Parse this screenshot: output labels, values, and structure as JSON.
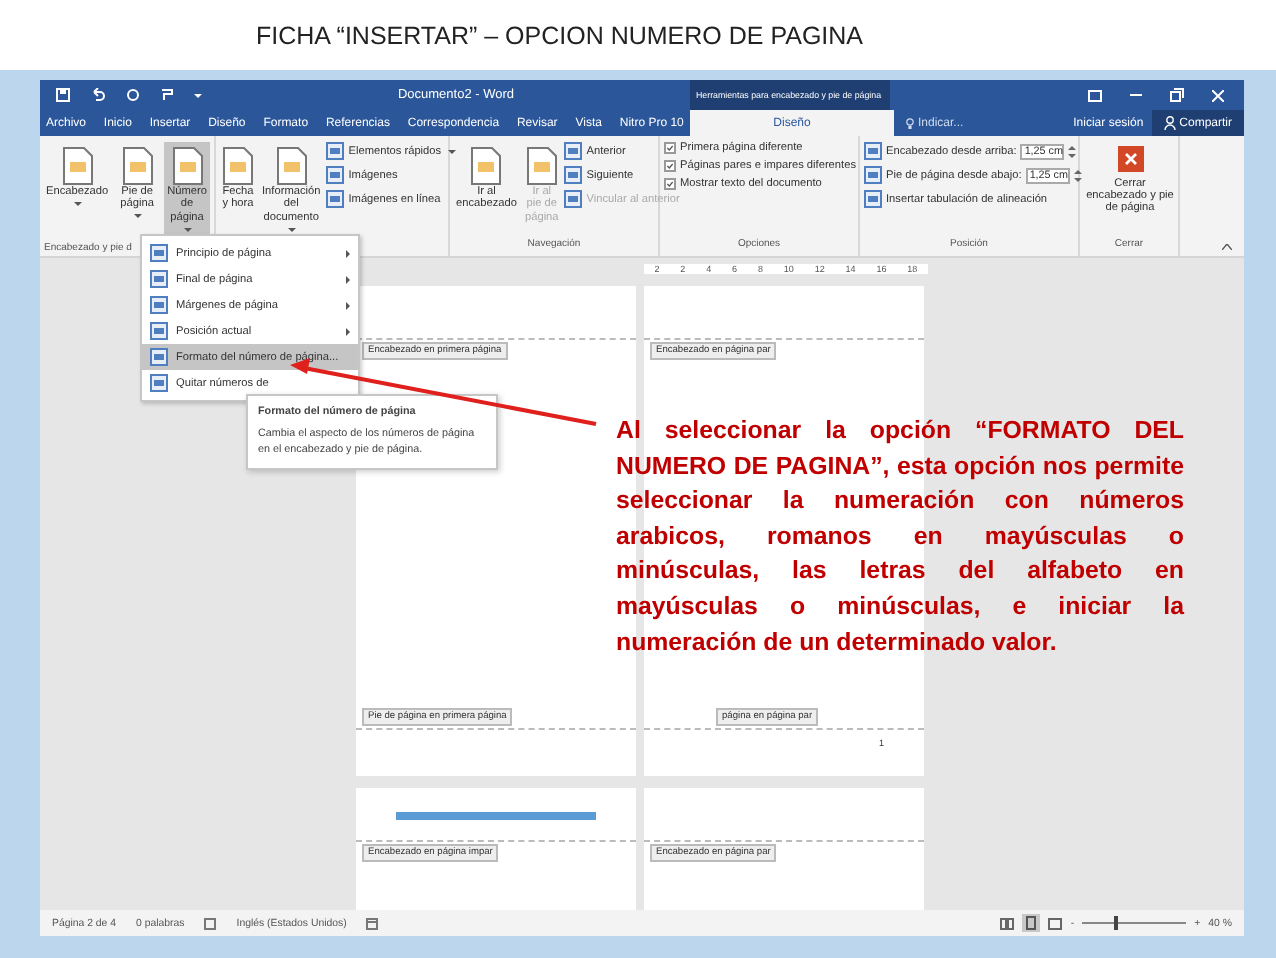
{
  "slide_title": "FICHA “INSERTAR” – OPCION NUMERO DE PAGINA",
  "window": {
    "title": "Documento2 - Word",
    "context_title": "Herramientas para encabezado y pie de página"
  },
  "tabs": [
    {
      "label": "Archivo",
      "selected": false
    },
    {
      "label": "Inicio",
      "selected": false
    },
    {
      "label": "Insertar",
      "selected": false
    },
    {
      "label": "Diseño",
      "selected": false
    },
    {
      "label": "Formato",
      "selected": false
    },
    {
      "label": "Referencias",
      "selected": false
    },
    {
      "label": "Correspondencia",
      "selected": false
    },
    {
      "label": "Revisar",
      "selected": false
    },
    {
      "label": "Vista",
      "selected": false
    },
    {
      "label": "Nitro Pro 10",
      "selected": false
    },
    {
      "label": "Diseño",
      "selected": true
    }
  ],
  "search": {
    "placeholder": "Indicar..."
  },
  "account": {
    "sign_in": "Iniciar sesión",
    "share": "Compartir"
  },
  "ribbon": [
    {
      "label": "Encabezado y pie d",
      "columns": [
        [
          {
            "kind": "large",
            "label": "Encabezado",
            "dropdown": true,
            "selected": false
          }
        ],
        [
          {
            "kind": "large",
            "label": "Pie de página",
            "dropdown": true,
            "selected": false
          }
        ],
        [
          {
            "kind": "large",
            "label": "Número de página",
            "dropdown": true,
            "selected": true
          }
        ]
      ]
    },
    {
      "columns": [
        [
          {
            "kind": "large",
            "label": "Fecha y hora",
            "dropdown": false,
            "selected": false
          }
        ],
        [
          {
            "kind": "large",
            "label": "Información del documento",
            "dropdown": true,
            "selected": false
          }
        ],
        [
          {
            "kind": "small",
            "label": "Elementos rápidos",
            "dropdown": true
          },
          {
            "kind": "small",
            "label": "Imágenes",
            "dropdown": false
          },
          {
            "kind": "small",
            "label": "Imágenes en línea",
            "dropdown": false
          }
        ]
      ]
    },
    {
      "label": "Navegación",
      "columns": [
        [
          {
            "kind": "large",
            "label": "Ir al encabezado",
            "disabled": false
          }
        ],
        [
          {
            "kind": "large",
            "label": "Ir al pie de página",
            "disabled": true
          }
        ],
        [
          {
            "kind": "small",
            "label": "Anterior",
            "disabled": false
          },
          {
            "kind": "small",
            "label": "Siguiente",
            "disabled": false
          },
          {
            "kind": "small",
            "label": "Vincular al anterior",
            "disabled": true
          }
        ]
      ]
    },
    {
      "label": "Opciones",
      "columns": [
        [
          {
            "kind": "check",
            "label": "Primera página diferente",
            "checked": true
          },
          {
            "kind": "check",
            "label": "Páginas pares e impares diferentes",
            "checked": true
          },
          {
            "kind": "check",
            "label": "Mostrar texto del documento",
            "checked": true
          }
        ]
      ]
    },
    {
      "label": "Posición",
      "columns": [
        [
          {
            "kind": "spin",
            "label": "Encabezado desde arriba:",
            "value": "1,25 cm"
          },
          {
            "kind": "spin",
            "label": "Pie de página desde abajo:",
            "value": "1,25 cm"
          },
          {
            "kind": "small",
            "label": "Insertar tabulación de alineación",
            "dropdown": false
          }
        ]
      ]
    },
    {
      "label": "Cerrar",
      "columns": [
        [
          {
            "kind": "close",
            "label": "Cerrar encabezado y pie de página"
          }
        ]
      ]
    }
  ],
  "menu": {
    "items": [
      {
        "label": "Principio de página",
        "submenu": true,
        "selected": false
      },
      {
        "label": "Final de página",
        "submenu": true,
        "selected": false
      },
      {
        "label": "Márgenes de página",
        "submenu": true,
        "selected": false
      },
      {
        "label": "Posición actual",
        "submenu": true,
        "selected": false
      },
      {
        "label": "Formato del número de página...",
        "submenu": false,
        "selected": true
      },
      {
        "label": "Quitar números de",
        "submenu": false,
        "selected": false
      }
    ]
  },
  "tooltip": {
    "title": "Formato del número de página",
    "text": "Cambia el aspecto de los números de página en el encabezado y pie de página."
  },
  "ruler": {
    "ticks": [
      "2",
      "2",
      "4",
      "6",
      "8",
      "10",
      "12",
      "14",
      "16",
      "18"
    ]
  },
  "pages": [
    {
      "header_label": "Encabezado en primera página",
      "footer_label": "Pie de página en primera página",
      "section_bar": false
    },
    {
      "header_label": "Encabezado en página par",
      "footer_label": "página en página par",
      "page_number": "1",
      "section_bar": false
    },
    {
      "header_label": "Encabezado en página impar",
      "section_bar": true
    },
    {
      "header_label": "Encabezado en página par",
      "section_bar": false
    }
  ],
  "annotation": {
    "text": "Al seleccionar la opción “FORMATO DEL NUMERO DE PAGINA”, esta opción nos permite seleccionar la numeración con números arabicos, romanos en mayúsculas o minúsculas, las letras del alfabeto en mayúsculas o minúsculas, e iniciar la numeración de un determinado valor."
  },
  "status_bar": {
    "items": [
      "Página 2 de 4",
      "0 palabras",
      "Inglés (Estados Unidos)"
    ],
    "zoom": {
      "minus": "-",
      "plus": "+",
      "level": 0.3,
      "reading": "40 %"
    }
  }
}
